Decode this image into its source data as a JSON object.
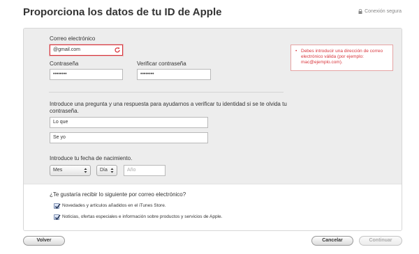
{
  "header": {
    "title": "Proporciona los datos de tu ID de Apple",
    "secure_label": "Conexión segura",
    "secure_icon": "lock-icon"
  },
  "form": {
    "email": {
      "label": "Correo electrónico",
      "value": "@gmail.com"
    },
    "password": {
      "label": "Contraseña",
      "value": "••••••••"
    },
    "verify_password": {
      "label": "Verificar contraseña",
      "value": "••••••••"
    },
    "error_message": "Debes introducir una dirección de correo electrónico válida (por ejemplo: mac@ejemplo.com).",
    "error_bullet": "•",
    "question_prompt": "Introduce una pregunta y una respuesta para ayudarnos a verificar tu identidad si se te olvida tu contraseña.",
    "question_value": "Lo que",
    "answer_value": "Se yo",
    "birthdate_prompt": "Introduce tu fecha de nacimiento.",
    "month_select": "Mes",
    "day_select": "Día",
    "year_placeholder": "Año"
  },
  "newsletter": {
    "prompt": "¿Te gustaría recibir lo siguiente por correo electrónico?",
    "options": [
      {
        "label": "Novedades y artículos añadidos en el iTunes Store.",
        "checked": true
      },
      {
        "label": "Noticias, ofertas especiales e información sobre productos y servicios de Apple.",
        "checked": true
      }
    ]
  },
  "buttons": {
    "back": "Volver",
    "cancel": "Cancelar",
    "continue": "Continuar"
  },
  "colors": {
    "error": "#d8343b",
    "panel_bg": "#ededed"
  }
}
